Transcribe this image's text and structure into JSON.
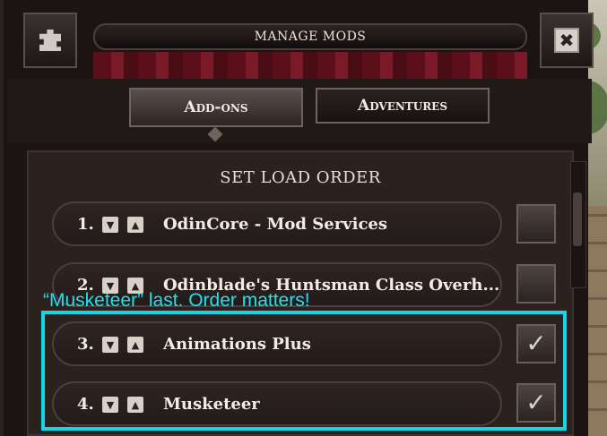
{
  "header": {
    "title": "MANAGE MODS",
    "left_icon": "puzzle-icon",
    "close_icon": "close-icon"
  },
  "tabs": [
    {
      "label": "Add-ons",
      "active": true
    },
    {
      "label": "Adventures",
      "active": false
    }
  ],
  "section_title": "SET LOAD ORDER",
  "mods": [
    {
      "index": "1.",
      "name": "OdinCore - Mod Services",
      "enabled": false
    },
    {
      "index": "2.",
      "name": "Odinblade's Huntsman Class Overh...",
      "enabled": false
    },
    {
      "index": "3.",
      "name": "Animations Plus",
      "enabled": true
    },
    {
      "index": "4.",
      "name": "Musketeer",
      "enabled": true
    }
  ],
  "annotation": "“Musketeer” last. Order matters!",
  "colors": {
    "highlight": "#13d6e6",
    "annotation_text": "#22e0ee"
  }
}
